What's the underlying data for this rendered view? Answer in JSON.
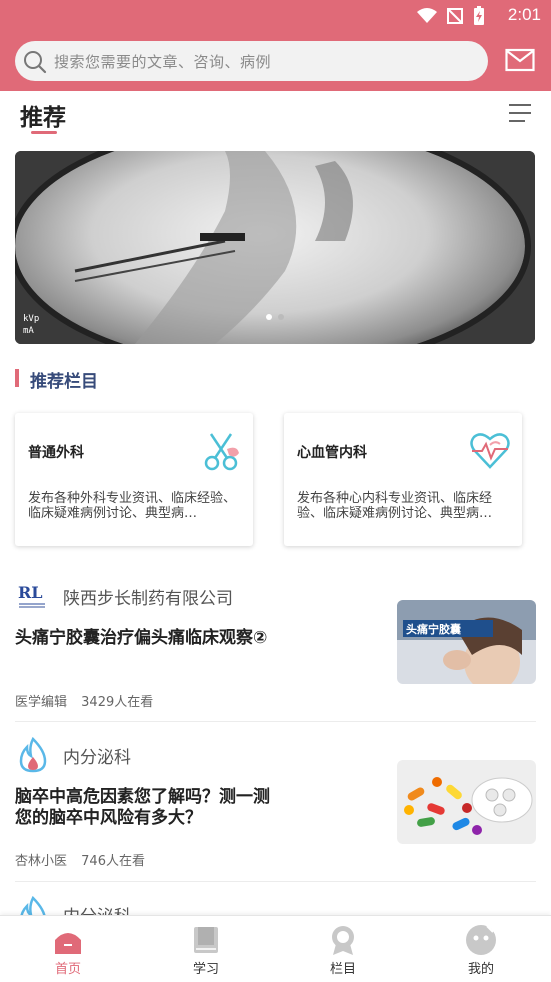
{
  "status": {
    "time": "2:01"
  },
  "search": {
    "placeholder": "搜索您需要的文章、咨询、病例"
  },
  "tabs": {
    "active": "推荐"
  },
  "section": {
    "title": "推荐栏目"
  },
  "cards": [
    {
      "title": "普通外科",
      "desc": "发布各种外科专业资讯、临床经验、临床疑难病例讨论、典型病…",
      "icon": "scissors-icon"
    },
    {
      "title": "心血管内科",
      "desc": "发布各种心内科专业资讯、临床经验、临床疑难病例讨论、典型病…",
      "icon": "heart-pulse-icon"
    }
  ],
  "articles": [
    {
      "source": "陕西步长制药有限公司",
      "title": "头痛宁胶囊治疗偏头痛临床观察②",
      "author": "医学编辑",
      "views": "3429人在看",
      "thumb_caption": "头痛宁胶囊"
    },
    {
      "source": "内分泌科",
      "title": "脑卒中高危因素您了解吗？测一测您的脑卒中风险有多大？",
      "author": "杏林小医",
      "views": "746人在看"
    },
    {
      "source": "内分泌科"
    }
  ],
  "nav": [
    {
      "label": "首页",
      "icon": "home-icon",
      "active": true
    },
    {
      "label": "学习",
      "icon": "book-icon",
      "active": false
    },
    {
      "label": "栏目",
      "icon": "badge-icon",
      "active": false
    },
    {
      "label": "我的",
      "icon": "profile-icon",
      "active": false
    }
  ],
  "colors": {
    "accent": "#e06a78",
    "section_title": "#374b7a"
  }
}
